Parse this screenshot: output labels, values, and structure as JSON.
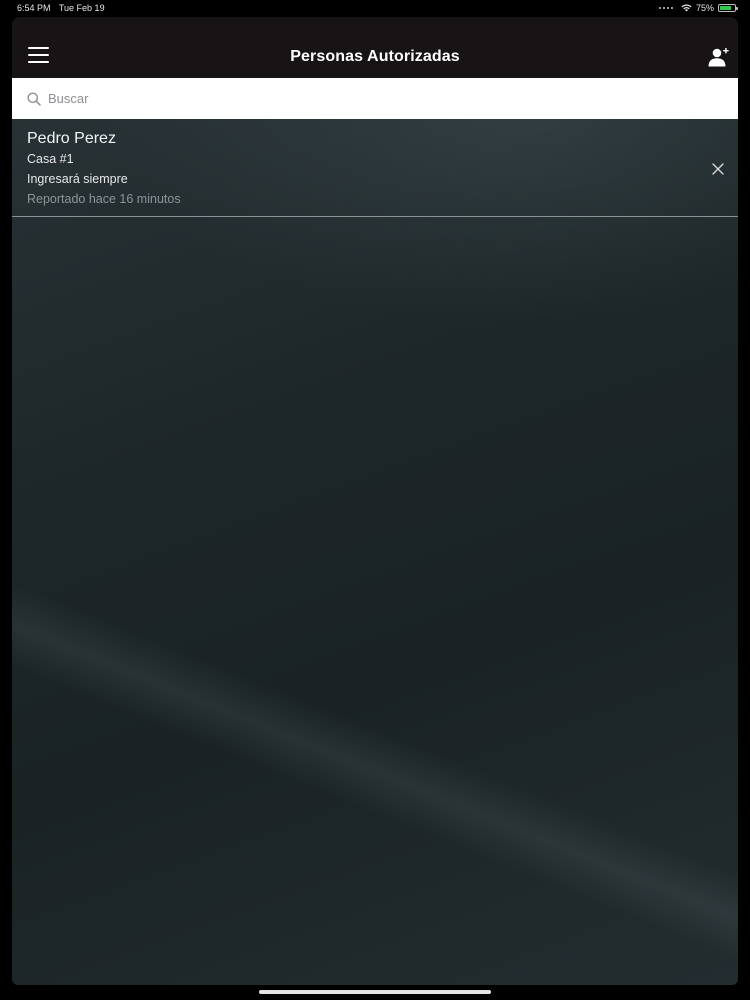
{
  "status_bar": {
    "time": "6:54 PM",
    "date": "Tue Feb 19",
    "battery": "75%",
    "battery_level": 0.75,
    "icons": [
      "wifi-icon",
      "battery-icon"
    ]
  },
  "header": {
    "title": "Personas Autorizadas",
    "menu_icon": "hamburger-menu-icon",
    "add_icon": "add-person-icon"
  },
  "search": {
    "placeholder": "Buscar",
    "value": ""
  },
  "persons": [
    {
      "name": "Pedro Perez",
      "house": "Casa #1",
      "schedule": "Ingresará siempre",
      "reported": "Reportado hace 16 minutos"
    }
  ],
  "colors": {
    "header_bg": "#181315",
    "search_bg": "#ffffff",
    "background": "#1f282b",
    "battery": "#32c84a"
  }
}
